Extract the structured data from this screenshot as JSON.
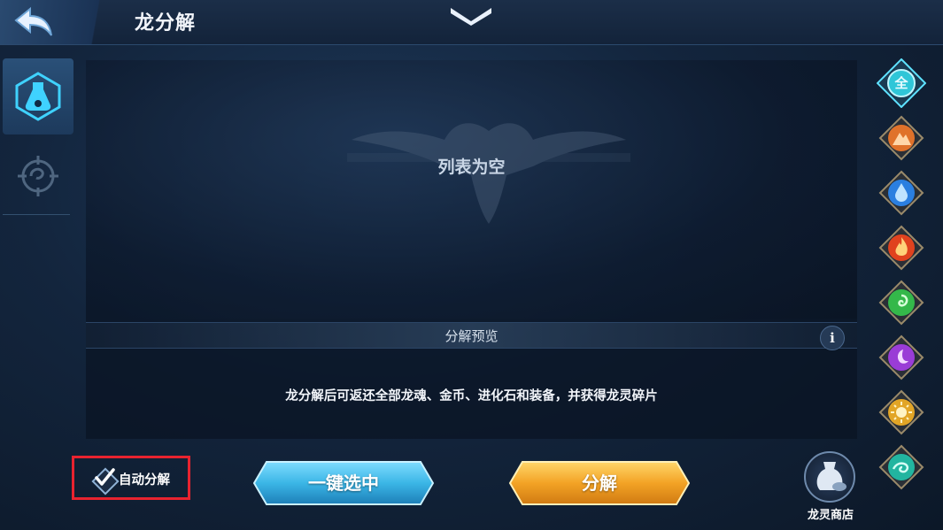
{
  "header": {
    "title": "龙分解",
    "back_icon": "back-arrow-icon",
    "collapse_icon": "chevron-down-icon"
  },
  "left_tabs": [
    {
      "icon": "potion-flask-icon",
      "active": true
    },
    {
      "icon": "dragon-crest-icon",
      "active": false
    }
  ],
  "list": {
    "empty_text": "列表为空",
    "emblem_icon": "twin-dragon-emblem-icon"
  },
  "preview": {
    "title": "分解预览",
    "info_icon": "info-icon",
    "info_glyph": "i",
    "description": "龙分解后可返还全部龙魂、金币、进化石和装备，并获得龙灵碎片"
  },
  "auto_decompose": {
    "label": "自动分解",
    "checked": true
  },
  "buttons": {
    "select_all_label": "一键选中",
    "decompose_label": "分解"
  },
  "shop": {
    "label": "龙灵商店",
    "icon": "potion-bag-icon"
  },
  "element_filters": [
    {
      "name": "all",
      "glyph": "全",
      "color": "#2fc6d8",
      "selected": true
    },
    {
      "name": "earth",
      "icon": "mountain-icon",
      "color": "#e0722a"
    },
    {
      "name": "water",
      "icon": "water-drop-icon",
      "color": "#2b7fe0"
    },
    {
      "name": "fire",
      "icon": "flame-icon",
      "color": "#e0421e"
    },
    {
      "name": "wind",
      "icon": "swirl-icon",
      "color": "#34b84a"
    },
    {
      "name": "dark",
      "icon": "moon-icon",
      "color": "#9a3cd6"
    },
    {
      "name": "light",
      "icon": "sun-icon",
      "color": "#e2a526"
    },
    {
      "name": "ocean",
      "icon": "wave-swirl-icon",
      "color": "#22b5a0"
    }
  ],
  "colors": {
    "accent_cyan": "#3fd2ff",
    "button_blue": "#3bb6e6",
    "button_gold": "#f3a325",
    "highlight_red": "#e8232f"
  }
}
